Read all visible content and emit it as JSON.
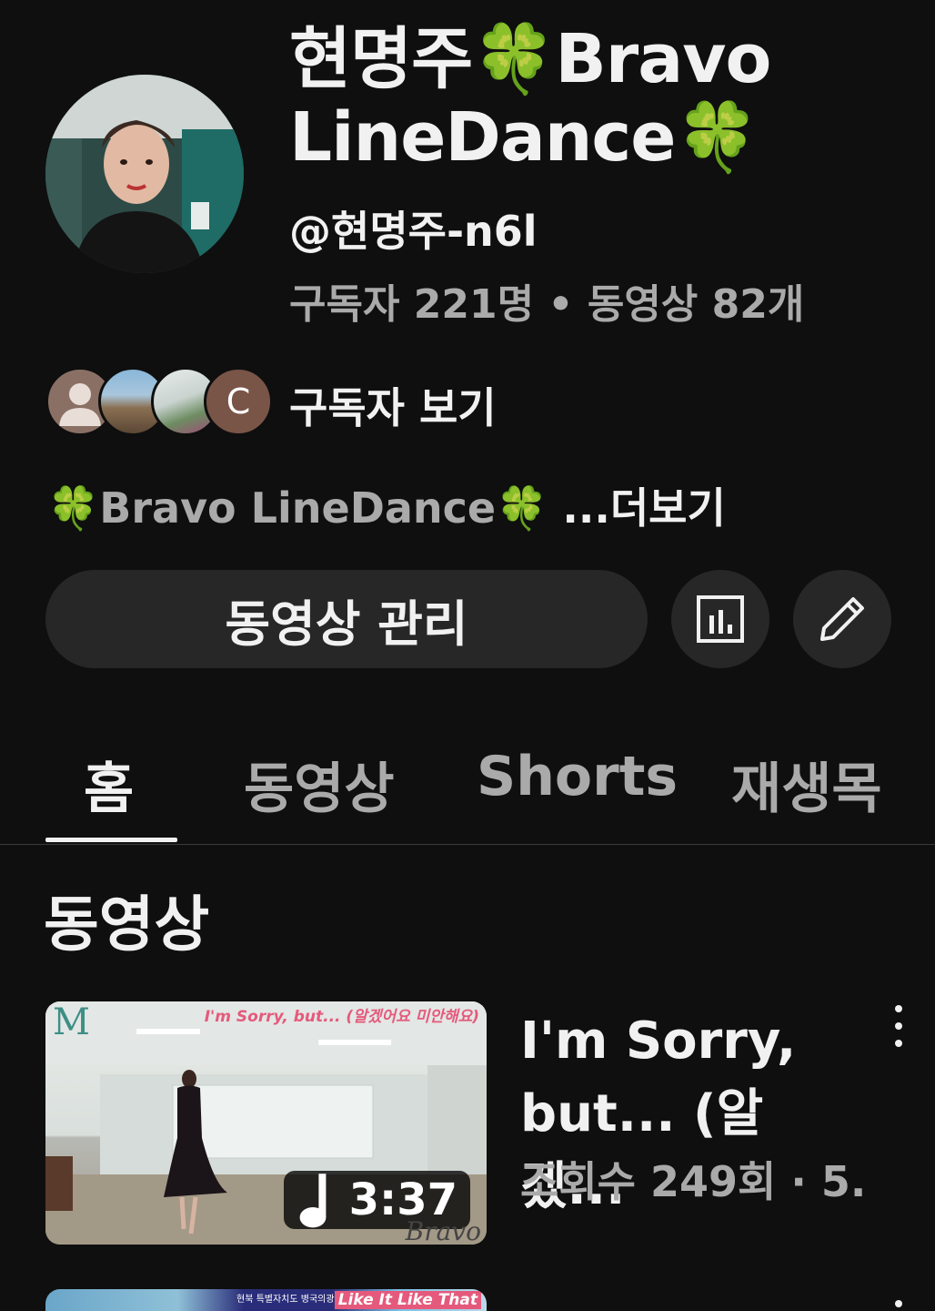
{
  "channel": {
    "name_part1": "현명주",
    "clover": "🍀",
    "name_part2": "Bravo",
    "name_part3": "LineDance",
    "handle": "@현명주-n6l",
    "stats": "구독자 221명 • 동영상 82개",
    "subscriber_initial": "C",
    "view_subscribers_label": "구독자 보기",
    "description": "🍀Bravo LineDance🍀",
    "more_label": "...더보기"
  },
  "actions": {
    "manage_videos_label": "동영상 관리",
    "analytics_icon": "analytics-icon",
    "edit_icon": "pencil-icon"
  },
  "tabs": [
    {
      "label": "홈",
      "active": true
    },
    {
      "label": "동영상",
      "active": false
    },
    {
      "label": "Shorts",
      "active": false
    },
    {
      "label": "재생목",
      "active": false
    }
  ],
  "section": {
    "title": "동영상"
  },
  "videos": [
    {
      "thumb_caption": "I'm Sorry, but... (알겠어요 미안해요)",
      "thumb_logo": "M",
      "thumb_brand": "Bravo",
      "duration": "3:37",
      "title": "I'm Sorry, but... (알겠...",
      "meta": "조회수 249회 · 5."
    },
    {
      "thumb_caption": "Like It Like That",
      "thumb_small": "현북 특별자치도 병국의광역파단"
    }
  ],
  "colors": {
    "background": "#0f0f0f",
    "primary_text": "#f1f1f1",
    "secondary_text": "#aaaaaa",
    "button_bg": "#272727",
    "clover_green": "#2fb24a"
  }
}
